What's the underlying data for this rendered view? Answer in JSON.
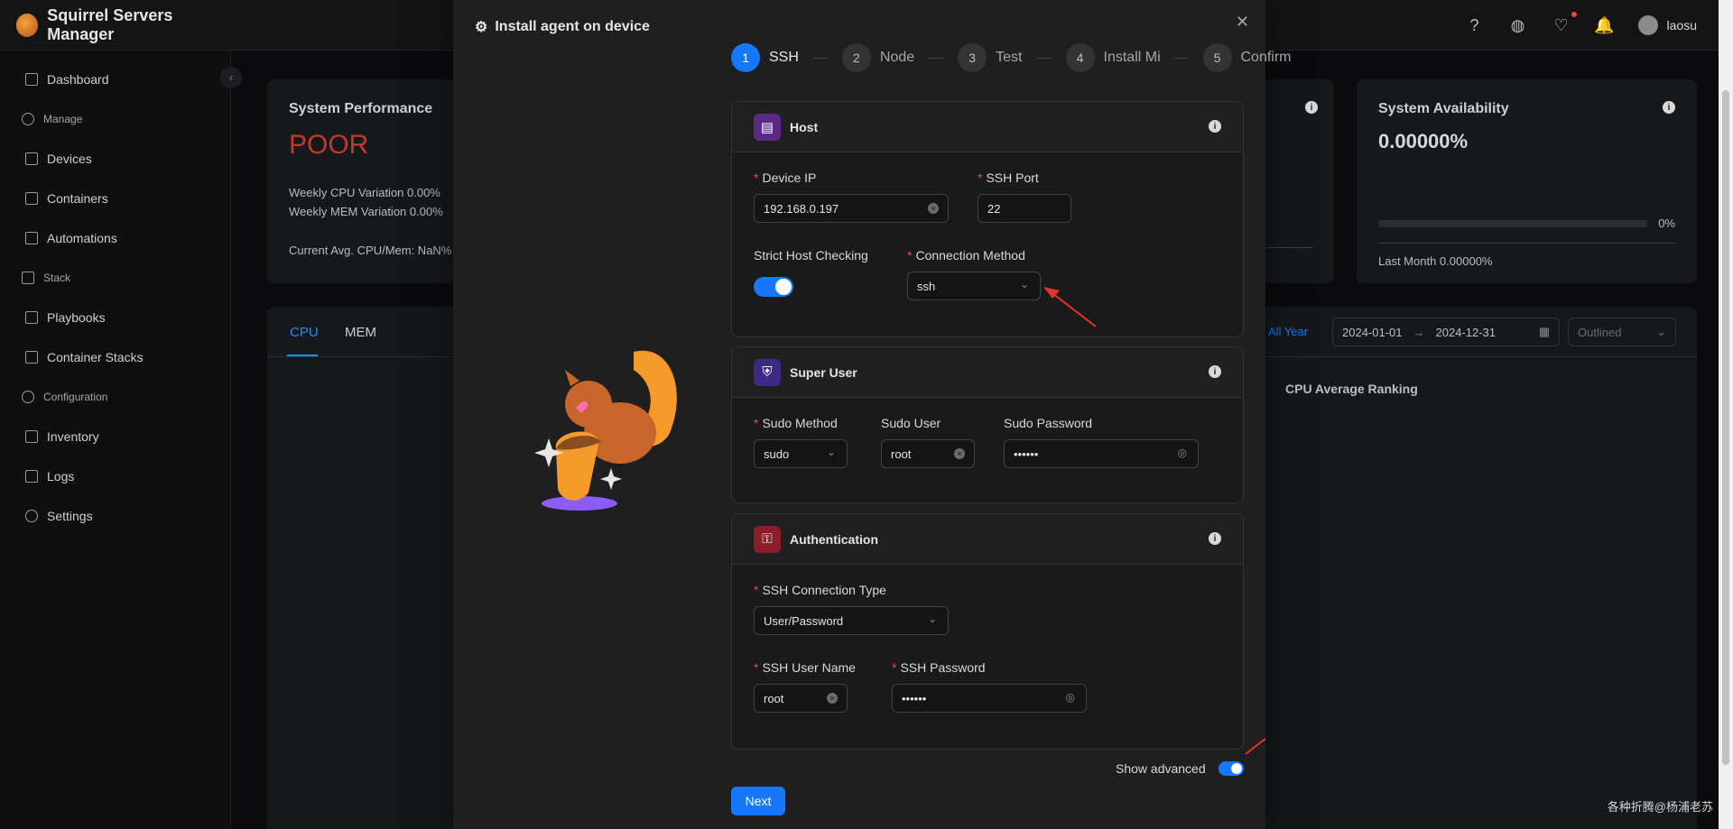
{
  "app": {
    "title": "Squirrel Servers Manager"
  },
  "header": {
    "user_name": "laosu"
  },
  "sidebar": {
    "items": [
      {
        "label": "Dashboard",
        "type": "item"
      },
      {
        "label": "Manage",
        "type": "group"
      },
      {
        "label": "Devices",
        "type": "item"
      },
      {
        "label": "Containers",
        "type": "item"
      },
      {
        "label": "Automations",
        "type": "item"
      },
      {
        "label": "Stack",
        "type": "group"
      },
      {
        "label": "Playbooks",
        "type": "item"
      },
      {
        "label": "Container Stacks",
        "type": "item"
      },
      {
        "label": "Configuration",
        "type": "group"
      },
      {
        "label": "Inventory",
        "type": "item"
      },
      {
        "label": "Logs",
        "type": "item"
      },
      {
        "label": "Settings",
        "type": "item"
      }
    ]
  },
  "dashboard": {
    "perf": {
      "title": "System Performance",
      "status": "POOR",
      "cpu_var": "Weekly CPU Variation  0.00%",
      "mem_var": "Weekly MEM Variation  0.00%",
      "avg": "Current Avg. CPU/Mem: NaN%"
    },
    "availability": {
      "title": "System Availability",
      "value": "0.00000%",
      "percent": "0%",
      "progress": 0,
      "last_month": "Last Month  0.00000%"
    },
    "tabs": [
      "CPU",
      "MEM"
    ],
    "range_label": "All Year",
    "date_start": "2024-01-01",
    "date_end": "2024-12-31",
    "style_select": "Outlined",
    "ranking_title": "CPU Average Ranking"
  },
  "modal": {
    "title": "Install agent on device",
    "steps": [
      {
        "num": "1",
        "label": "SSH"
      },
      {
        "num": "2",
        "label": "Node"
      },
      {
        "num": "3",
        "label": "Test"
      },
      {
        "num": "4",
        "label": "Install Mi"
      },
      {
        "num": "5",
        "label": "Confirm"
      }
    ],
    "host": {
      "title": "Host",
      "device_ip_label": "Device IP",
      "device_ip_value": "192.168.0.197",
      "ssh_port_label": "SSH Port",
      "ssh_port_value": "22",
      "strict_label": "Strict Host Checking",
      "conn_method_label": "Connection Method",
      "conn_method_value": "ssh"
    },
    "super_user": {
      "title": "Super User",
      "sudo_method_label": "Sudo Method",
      "sudo_method_value": "sudo",
      "sudo_user_label": "Sudo User",
      "sudo_user_value": "root",
      "sudo_password_label": "Sudo Password",
      "sudo_password_value": "••••••"
    },
    "auth": {
      "title": "Authentication",
      "conn_type_label": "SSH Connection Type",
      "conn_type_value": "User/Password",
      "user_label": "SSH User Name",
      "user_value": "root",
      "password_label": "SSH Password",
      "password_value": "••••••"
    },
    "show_advanced_label": "Show advanced",
    "next_label": "Next"
  },
  "watermark": "各种折腾@杨浦老苏",
  "colors": {
    "primary": "#1677ff",
    "danger": "#c0392b"
  }
}
